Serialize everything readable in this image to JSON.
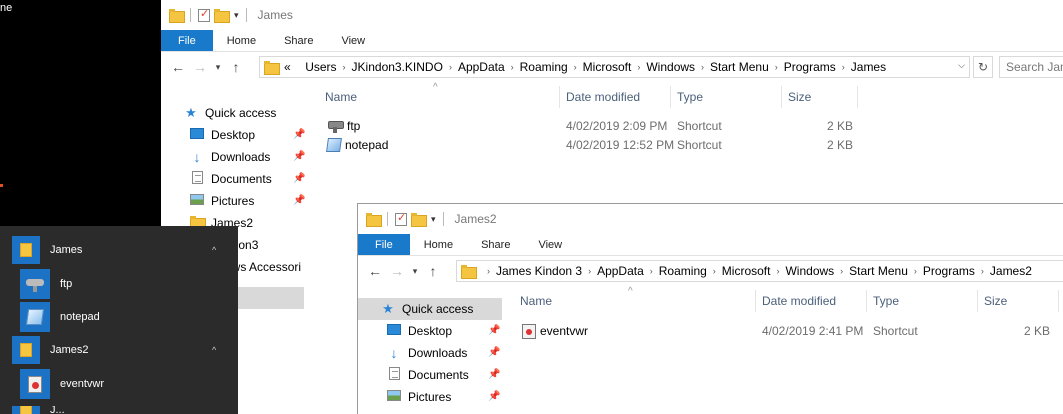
{
  "background_fragment": "ne",
  "window1": {
    "title": "James",
    "ribbon_tabs": [
      "File",
      "Home",
      "Share",
      "View"
    ],
    "breadcrumb": [
      "«",
      "Users",
      "JKindon3.KINDO",
      "AppData",
      "Roaming",
      "Microsoft",
      "Windows",
      "Start Menu",
      "Programs",
      "James"
    ],
    "search_placeholder": "Search James",
    "nav": [
      {
        "label": "Quick access"
      },
      {
        "label": "Desktop"
      },
      {
        "label": "Downloads"
      },
      {
        "label": "Documents"
      },
      {
        "label": "Pictures"
      },
      {
        "label": "James2"
      },
      {
        "label": "ndon3"
      },
      {
        "label": "ows Accessori"
      }
    ],
    "columns": [
      "Name",
      "Date modified",
      "Type",
      "Size"
    ],
    "files": [
      {
        "name": "ftp",
        "date": "4/02/2019 2:09 PM",
        "type": "Shortcut",
        "size": "2 KB"
      },
      {
        "name": "notepad",
        "date": "4/02/2019 12:52 PM",
        "type": "Shortcut",
        "size": "2 KB"
      }
    ]
  },
  "window2": {
    "title": "James2",
    "ribbon_tabs": [
      "File",
      "Home",
      "Share",
      "View"
    ],
    "breadcrumb": [
      "James Kindon 3",
      "AppData",
      "Roaming",
      "Microsoft",
      "Windows",
      "Start Menu",
      "Programs",
      "James2"
    ],
    "nav": [
      {
        "label": "Quick access"
      },
      {
        "label": "Desktop"
      },
      {
        "label": "Downloads"
      },
      {
        "label": "Documents"
      },
      {
        "label": "Pictures"
      }
    ],
    "columns": [
      "Name",
      "Date modified",
      "Type",
      "Size"
    ],
    "files": [
      {
        "name": "eventvwr",
        "date": "4/02/2019 2:41 PM",
        "type": "Shortcut",
        "size": "2 KB"
      }
    ]
  },
  "startmenu": {
    "items": [
      {
        "label": "James"
      },
      {
        "label": "ftp"
      },
      {
        "label": "notepad"
      },
      {
        "label": "James2"
      },
      {
        "label": "eventvwr"
      },
      {
        "label": "J..."
      }
    ]
  }
}
